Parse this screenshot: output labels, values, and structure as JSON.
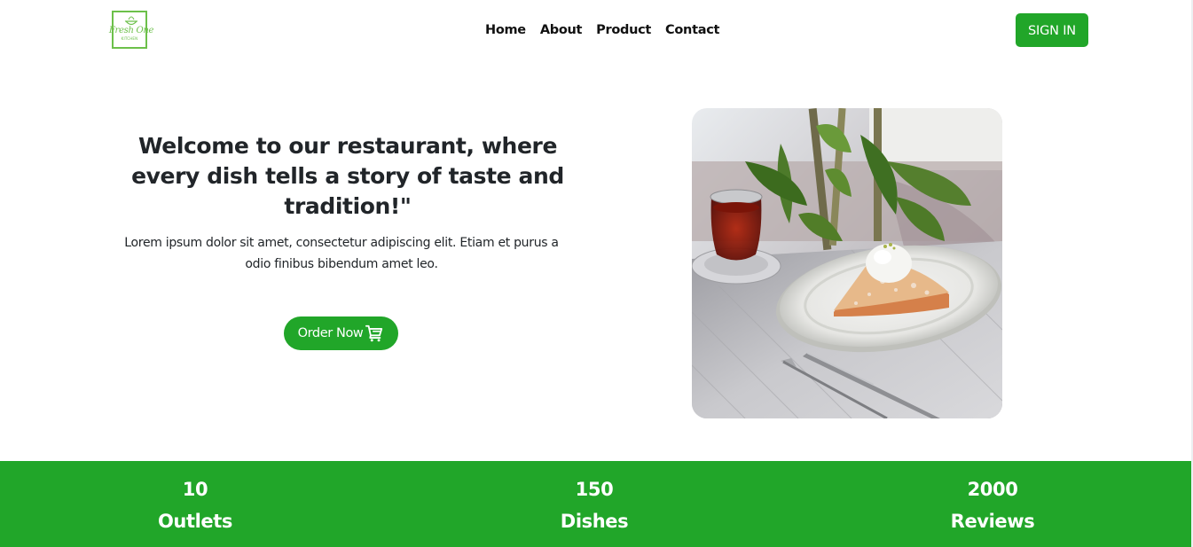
{
  "header": {
    "logo": {
      "script_text": "Fresh One",
      "sub_text": "KITCHEN",
      "accent_color": "#6cc04a",
      "icon": "bowl-icon"
    },
    "nav": [
      {
        "label": "Home"
      },
      {
        "label": "About"
      },
      {
        "label": "Product"
      },
      {
        "label": "Contact"
      }
    ],
    "sign_in_label": "SIGN IN"
  },
  "hero": {
    "title": "Welcome to our restaurant, where every dish tells a story of taste and tradition!\"",
    "text": "Lorem ipsum dolor sit amet, consectetur adipiscing elit. Etiam et purus a odio finibus bibendum amet leo.",
    "order_label": "Order Now",
    "order_icon": "cart-icon",
    "image": "photo of a slice of pie with ice cream on a white plate, a glass of tea, fork and knife on a wooden table with plants"
  },
  "stats": [
    {
      "value": "10",
      "label": "Outlets"
    },
    {
      "value": "150",
      "label": "Dishes"
    },
    {
      "value": "2000",
      "label": "Reviews"
    }
  ],
  "colors": {
    "brand_green": "#21a629",
    "logo_green": "#6cc04a",
    "text": "#212529",
    "background": "#ffffff"
  }
}
